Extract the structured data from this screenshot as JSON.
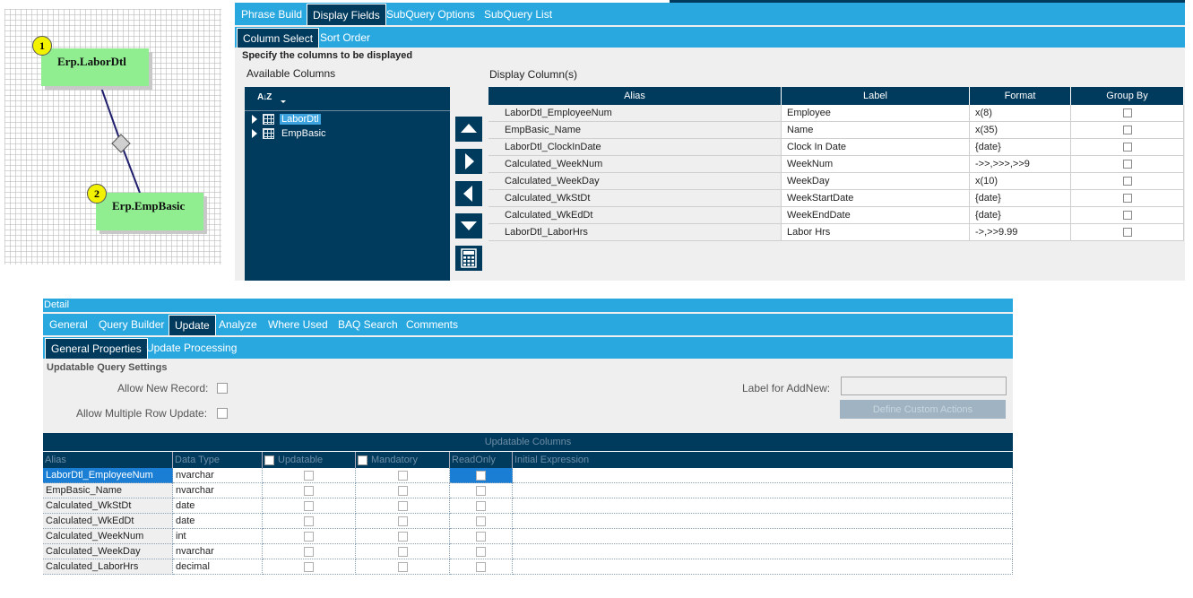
{
  "diagram": {
    "tables": [
      {
        "number": "1",
        "name": "Erp.LaborDtl"
      },
      {
        "number": "2",
        "name": "Erp.EmpBasic"
      }
    ]
  },
  "top_tabs": [
    "Phrase Build",
    "Display Fields",
    "SubQuery Options",
    "SubQuery List"
  ],
  "sub_tabs": [
    "Column Select",
    "Sort Order"
  ],
  "instruction": "Specify the columns to be displayed",
  "available_columns_label": "Available Columns",
  "display_columns_label": "Display Column(s)",
  "sort_icon_text": "A↓Z",
  "tree_items": [
    "LaborDtl",
    "EmpBasic"
  ],
  "display_grid": {
    "headers": [
      "Alias",
      "Label",
      "Format",
      "Group By"
    ],
    "rows": [
      {
        "alias": "LaborDtl_EmployeeNum",
        "label": "Employee",
        "format": "x(8)"
      },
      {
        "alias": "EmpBasic_Name",
        "label": "Name",
        "format": "x(35)"
      },
      {
        "alias": "LaborDtl_ClockInDate",
        "label": "Clock In Date",
        "format": "{date}"
      },
      {
        "alias": "Calculated_WeekNum",
        "label": "WeekNum",
        "format": "->>,>>>,>>9"
      },
      {
        "alias": "Calculated_WeekDay",
        "label": "WeekDay",
        "format": "x(10)"
      },
      {
        "alias": "Calculated_WkStDt",
        "label": "WeekStartDate",
        "format": "{date}"
      },
      {
        "alias": "Calculated_WkEdDt",
        "label": "WeekEndDate",
        "format": "{date}"
      },
      {
        "alias": "LaborDtl_LaborHrs",
        "label": "Labor Hrs",
        "format": "->,>>9.99"
      }
    ]
  },
  "detail_title": "Detail",
  "detail_tabs": [
    "General",
    "Query Builder",
    "Update",
    "Analyze",
    "Where Used",
    "BAQ Search",
    "Comments"
  ],
  "update_tabs": [
    "General Properties",
    "Update  Processing"
  ],
  "updatable_settings": {
    "title": "Updatable Query Settings",
    "allow_new_record": "Allow New Record:",
    "allow_multiple_row_update": "Allow Multiple Row Update:",
    "label_for_addnew": "Label for AddNew:",
    "define_custom_actions": "Define Custom Actions"
  },
  "updatable_columns": {
    "title": "Updatable Columns",
    "headers": [
      "Alias",
      "Data Type",
      "Updatable",
      "Mandatory",
      "ReadOnly",
      "Initial Expression"
    ],
    "rows": [
      {
        "alias": "LaborDtl_EmployeeNum",
        "type": "nvarchar"
      },
      {
        "alias": "EmpBasic_Name",
        "type": "nvarchar"
      },
      {
        "alias": "Calculated_WkStDt",
        "type": "date"
      },
      {
        "alias": "Calculated_WkEdDt",
        "type": "date"
      },
      {
        "alias": "Calculated_WeekNum",
        "type": "int"
      },
      {
        "alias": "Calculated_WeekDay",
        "type": "nvarchar"
      },
      {
        "alias": "Calculated_LaborHrs",
        "type": "decimal"
      }
    ]
  },
  "colors": {
    "dark_blue": "#003a5c",
    "light_blue": "#29a8e0",
    "node_green": "#90ee90",
    "badge_yellow": "#f2f200"
  }
}
